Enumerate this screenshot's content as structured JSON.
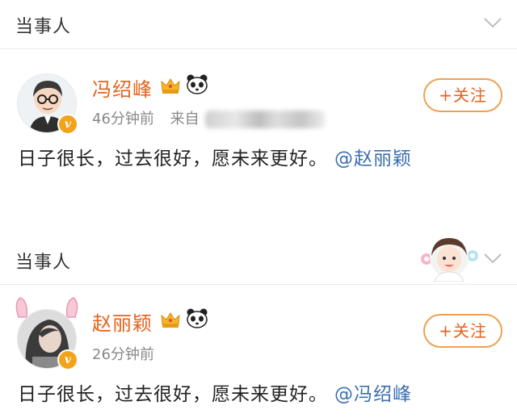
{
  "sections": [
    {
      "header": {
        "title": "当事人"
      },
      "post": {
        "username": "冯绍峰",
        "time": "46分钟前",
        "source_prefix": "来自",
        "follow_label": "+关注",
        "content_text": "日子很长，过去很好，愿未来更好。",
        "mention": "@赵丽颖"
      }
    },
    {
      "header": {
        "title": "当事人"
      },
      "post": {
        "username": "赵丽颖",
        "time": "26分钟前",
        "follow_label": "+关注",
        "content_text": "日子很长，过去很好，愿未来更好。",
        "mention": "@冯绍峰"
      }
    }
  ],
  "colors": {
    "username": "#e8621a",
    "mention": "#3a6fb0",
    "follow_border": "#f0a050",
    "verified": "#f2a31b"
  },
  "icons": [
    "chevron-down-icon",
    "crown-icon",
    "panda-icon",
    "verified-icon"
  ]
}
